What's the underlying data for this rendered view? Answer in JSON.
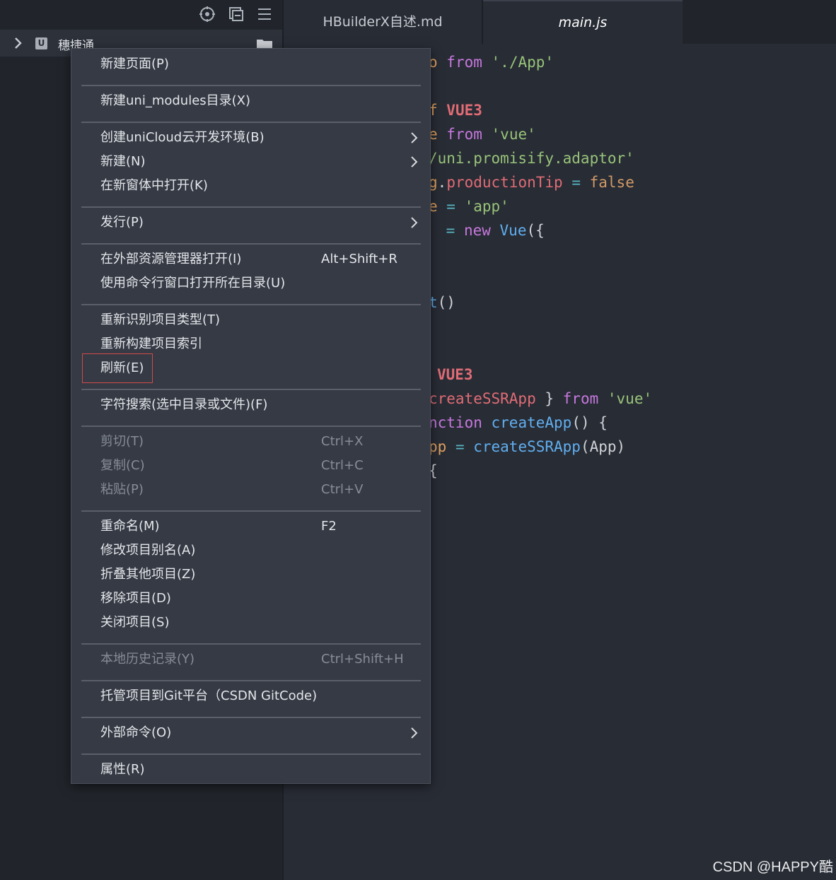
{
  "sidebar": {
    "project_name": "穗捷通",
    "project_badge": "U"
  },
  "tabs": [
    {
      "label": "HBuilderX自述.md",
      "active": false
    },
    {
      "label": "main.js",
      "active": true
    }
  ],
  "code_lines": [
    [
      {
        "t": "o ",
        "c": "#e0a060"
      },
      {
        "t": "from",
        "c": "#c678dd"
      },
      {
        "t": " ",
        "c": "#d0d2d6"
      },
      {
        "t": "'./App'",
        "c": "#98c379"
      }
    ],
    [],
    [
      {
        "t": "f ",
        "c": "#e0a060"
      },
      {
        "t": "VUE3",
        "c": "#e06c75",
        "b": true
      }
    ],
    [
      {
        "t": "e ",
        "c": "#e0a060"
      },
      {
        "t": "from",
        "c": "#c678dd"
      },
      {
        "t": " ",
        "c": "#d0d2d6"
      },
      {
        "t": "'vue'",
        "c": "#98c379"
      }
    ],
    [
      {
        "t": "/uni.promisify.adaptor'",
        "c": "#98c379"
      }
    ],
    [
      {
        "t": "g",
        "c": "#e0a060"
      },
      {
        "t": ".",
        "c": "#d0d2d6"
      },
      {
        "t": "productionTip",
        "c": "#e06c75"
      },
      {
        "t": " = ",
        "c": "#56b6c2"
      },
      {
        "t": "false",
        "c": "#d19a66"
      }
    ],
    [
      {
        "t": "e",
        "c": "#e0a060"
      },
      {
        "t": " = ",
        "c": "#56b6c2"
      },
      {
        "t": "'app'",
        "c": "#98c379"
      }
    ],
    [
      {
        "t": " = ",
        "c": "#56b6c2"
      },
      {
        "t": "new",
        "c": "#c678dd"
      },
      {
        "t": " ",
        "c": "#d0d2d6"
      },
      {
        "t": "Vue",
        "c": "#61afef"
      },
      {
        "t": "({",
        "c": "#d0d2d6"
      }
    ],
    [],
    [],
    [
      {
        "t": "t",
        "c": "#61afef"
      },
      {
        "t": "()",
        "c": "#d0d2d6"
      }
    ],
    [],
    [],
    [
      {
        "t": "VUE3",
        "c": "#e06c75",
        "b": true
      }
    ],
    [
      {
        "t": "createSSRApp",
        "c": "#e06c75"
      },
      {
        "t": " } ",
        "c": "#d0d2d6"
      },
      {
        "t": "from",
        "c": "#c678dd"
      },
      {
        "t": " ",
        "c": "#d0d2d6"
      },
      {
        "t": "'vue'",
        "c": "#98c379"
      }
    ],
    [
      {
        "t": "nction",
        "c": "#c678dd"
      },
      {
        "t": " ",
        "c": "#d0d2d6"
      },
      {
        "t": "createApp",
        "c": "#61afef"
      },
      {
        "t": "() {",
        "c": "#d0d2d6"
      }
    ],
    [
      {
        "t": "pp",
        "c": "#e0a060"
      },
      {
        "t": " = ",
        "c": "#56b6c2"
      },
      {
        "t": "createSSRApp",
        "c": "#61afef"
      },
      {
        "t": "(App)",
        "c": "#d0d2d6"
      }
    ],
    [
      {
        "t": "{",
        "c": "#d0d2d6"
      }
    ]
  ],
  "menu": {
    "items": [
      {
        "label": "新建页面(P)",
        "shortcut": "",
        "submenu": false,
        "disabled": false
      },
      {
        "sep": true
      },
      {
        "label": "新建uni_modules目录(X)",
        "shortcut": "",
        "submenu": false,
        "disabled": false
      },
      {
        "sep": true
      },
      {
        "label": "创建uniCloud云开发环境(B)",
        "shortcut": "",
        "submenu": true,
        "disabled": false
      },
      {
        "label": "新建(N)",
        "shortcut": "",
        "submenu": true,
        "disabled": false
      },
      {
        "label": "在新窗体中打开(K)",
        "shortcut": "",
        "submenu": false,
        "disabled": false
      },
      {
        "sep": true
      },
      {
        "label": "发行(P)",
        "shortcut": "",
        "submenu": true,
        "disabled": false
      },
      {
        "sep": true
      },
      {
        "label": "在外部资源管理器打开(I)",
        "shortcut": "Alt+Shift+R",
        "submenu": false,
        "disabled": false
      },
      {
        "label": "使用命令行窗口打开所在目录(U)",
        "shortcut": "",
        "submenu": false,
        "disabled": false
      },
      {
        "sep": true
      },
      {
        "label": "重新识别项目类型(T)",
        "shortcut": "",
        "submenu": false,
        "disabled": false
      },
      {
        "label": "重新构建项目索引",
        "shortcut": "",
        "submenu": false,
        "disabled": false
      },
      {
        "label": "刷新(E)",
        "shortcut": "",
        "submenu": false,
        "disabled": false,
        "highlight": true
      },
      {
        "sep": true
      },
      {
        "label": "字符搜索(选中目录或文件)(F)",
        "shortcut": "",
        "submenu": false,
        "disabled": false
      },
      {
        "sep": true
      },
      {
        "label": "剪切(T)",
        "shortcut": "Ctrl+X",
        "submenu": false,
        "disabled": true
      },
      {
        "label": "复制(C)",
        "shortcut": "Ctrl+C",
        "submenu": false,
        "disabled": true
      },
      {
        "label": "粘贴(P)",
        "shortcut": "Ctrl+V",
        "submenu": false,
        "disabled": true
      },
      {
        "sep": true
      },
      {
        "label": "重命名(M)",
        "shortcut": "F2",
        "submenu": false,
        "disabled": false
      },
      {
        "label": "修改项目别名(A)",
        "shortcut": "",
        "submenu": false,
        "disabled": false
      },
      {
        "label": "折叠其他项目(Z)",
        "shortcut": "",
        "submenu": false,
        "disabled": false
      },
      {
        "label": "移除项目(D)",
        "shortcut": "",
        "submenu": false,
        "disabled": false
      },
      {
        "label": "关闭项目(S)",
        "shortcut": "",
        "submenu": false,
        "disabled": false
      },
      {
        "sep": true
      },
      {
        "label": "本地历史记录(Y)",
        "shortcut": "Ctrl+Shift+H",
        "submenu": false,
        "disabled": true
      },
      {
        "sep": true
      },
      {
        "label": "托管项目到Git平台（CSDN GitCode)",
        "shortcut": "",
        "submenu": false,
        "disabled": false
      },
      {
        "sep": true
      },
      {
        "label": "外部命令(O)",
        "shortcut": "",
        "submenu": true,
        "disabled": false
      },
      {
        "sep": true
      },
      {
        "label": "属性(R)",
        "shortcut": "",
        "submenu": false,
        "disabled": false
      }
    ]
  },
  "watermark": "CSDN @HAPPY酷",
  "icons": {
    "toolbar": [
      "locate-icon",
      "collapse-all-icon",
      "menu-icon"
    ],
    "project_toggle": "chevron-right-icon",
    "folder": "folder-icon",
    "submenu": "chevron-right-icon"
  },
  "colors": {
    "highlight_border": "#d24a4a",
    "menu_bg": "#353a44",
    "sidebar_bg": "#21252b",
    "editor_bg": "#282c35"
  }
}
